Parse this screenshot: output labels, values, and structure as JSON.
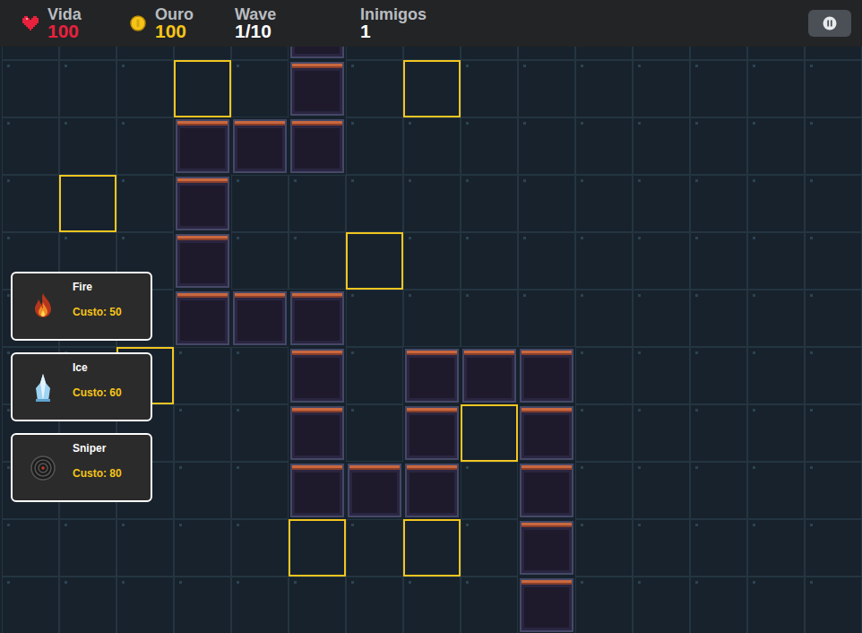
{
  "hud": {
    "stats": [
      {
        "label": "Vida",
        "value": "100",
        "kind": "life"
      },
      {
        "label": "Ouro",
        "value": "100",
        "kind": "gold"
      },
      {
        "label": "Wave",
        "value": "1/10",
        "kind": "wave"
      },
      {
        "label": "Inimigos",
        "value": "1",
        "kind": "enemies"
      }
    ],
    "paused": false
  },
  "towers": [
    {
      "name": "Fire",
      "cost": "Custo: 50",
      "kind": "fire"
    },
    {
      "name": "Ice",
      "cost": "Custo: 60",
      "kind": "ice"
    },
    {
      "name": "Sniper",
      "cost": "Custo: 80",
      "kind": "sniper"
    }
  ],
  "map": {
    "rows": [
      [
        "floor",
        "floor",
        "floor",
        "floor",
        "floor",
        "path",
        "floor",
        "floor",
        "floor",
        "floor",
        "floor",
        "floor",
        "floor",
        "floor",
        "floor"
      ],
      [
        "floor",
        "floor",
        "floor",
        "slot",
        "floor",
        "path",
        "floor",
        "slot",
        "floor",
        "floor",
        "floor",
        "floor",
        "floor",
        "floor",
        "floor"
      ],
      [
        "floor",
        "floor",
        "floor",
        "path",
        "path",
        "path",
        "floor",
        "floor",
        "floor",
        "floor",
        "floor",
        "floor",
        "floor",
        "floor",
        "floor"
      ],
      [
        "floor",
        "slot",
        "floor",
        "path",
        "floor",
        "floor",
        "floor",
        "floor",
        "floor",
        "floor",
        "floor",
        "floor",
        "floor",
        "floor",
        "floor"
      ],
      [
        "floor",
        "floor",
        "floor",
        "path",
        "floor",
        "floor",
        "slot",
        "floor",
        "floor",
        "floor",
        "floor",
        "floor",
        "floor",
        "floor",
        "floor"
      ],
      [
        "floor",
        "floor",
        "floor",
        "path",
        "path",
        "path",
        "floor",
        "floor",
        "floor",
        "floor",
        "floor",
        "floor",
        "floor",
        "floor",
        "floor"
      ],
      [
        "floor",
        "floor",
        "slot",
        "floor",
        "floor",
        "path",
        "floor",
        "path",
        "path",
        "path",
        "floor",
        "floor",
        "floor",
        "floor",
        "floor"
      ],
      [
        "floor",
        "floor",
        "floor",
        "floor",
        "floor",
        "path",
        "floor",
        "path",
        "slot",
        "path",
        "floor",
        "floor",
        "floor",
        "floor",
        "floor"
      ],
      [
        "floor",
        "floor",
        "floor",
        "floor",
        "floor",
        "path",
        "path",
        "path",
        "floor",
        "path",
        "floor",
        "floor",
        "floor",
        "floor",
        "floor"
      ],
      [
        "floor",
        "floor",
        "floor",
        "floor",
        "floor",
        "slot",
        "floor",
        "slot",
        "floor",
        "path",
        "floor",
        "floor",
        "floor",
        "floor",
        "floor"
      ],
      [
        "floor",
        "floor",
        "floor",
        "floor",
        "floor",
        "floor",
        "floor",
        "floor",
        "floor",
        "path",
        "floor",
        "floor",
        "floor",
        "floor",
        "floor"
      ]
    ]
  }
}
